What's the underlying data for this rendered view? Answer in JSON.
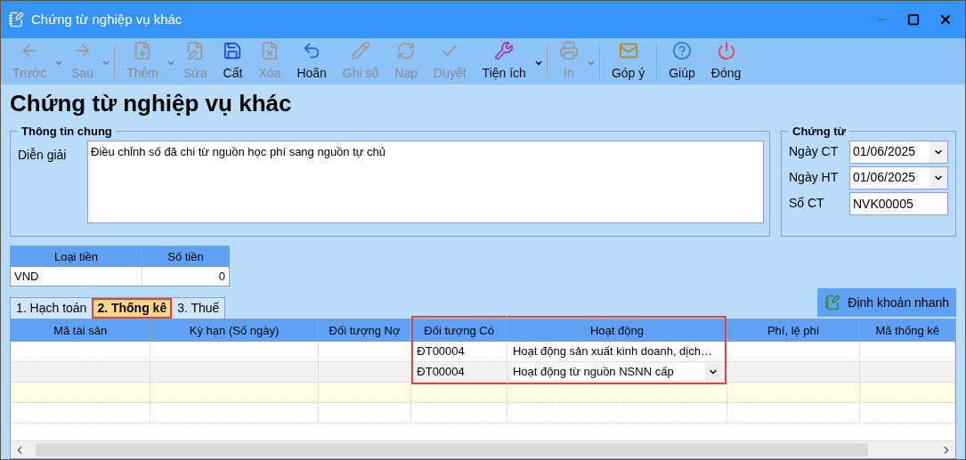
{
  "window": {
    "title": "Chứng từ nghiệp vụ khác"
  },
  "toolbar": [
    {
      "kind": "button",
      "label": "Trước",
      "disabled": true,
      "dropdown": true
    },
    {
      "kind": "button",
      "label": "Sau",
      "disabled": true,
      "dropdown": true
    },
    {
      "kind": "separator"
    },
    {
      "kind": "button",
      "label": "Thêm",
      "disabled": true,
      "dropdown": true
    },
    {
      "kind": "button",
      "label": "Sửa",
      "disabled": true,
      "dropdown": false
    },
    {
      "kind": "button",
      "label": "Cất",
      "disabled": false,
      "dropdown": false
    },
    {
      "kind": "button",
      "label": "Xóa",
      "disabled": true,
      "dropdown": false
    },
    {
      "kind": "button",
      "label": "Hoãn",
      "disabled": false,
      "dropdown": false
    },
    {
      "kind": "button",
      "label": "Ghi sổ",
      "disabled": true,
      "dropdown": false
    },
    {
      "kind": "button",
      "label": "Nạp",
      "disabled": true,
      "dropdown": false
    },
    {
      "kind": "button",
      "label": "Duyệt",
      "disabled": true,
      "dropdown": false
    },
    {
      "kind": "button",
      "label": "Tiện ích",
      "disabled": false,
      "dropdown": true
    },
    {
      "kind": "separator"
    },
    {
      "kind": "button",
      "label": "In",
      "disabled": true,
      "dropdown": true
    },
    {
      "kind": "separator"
    },
    {
      "kind": "button",
      "label": "Góp ý",
      "disabled": false,
      "dropdown": false
    },
    {
      "kind": "separator"
    },
    {
      "kind": "button",
      "label": "Giúp",
      "disabled": false,
      "dropdown": false
    },
    {
      "kind": "button",
      "label": "Đóng",
      "disabled": false,
      "dropdown": false
    }
  ],
  "heading": "Chứng từ nghiệp vụ khác",
  "general": {
    "title": "Thông tin chung",
    "label": "Diễn giải",
    "value": "Điều chỉnh số đã chi từ nguồn học phí sang nguồn tự chủ"
  },
  "voucher": {
    "title": "Chứng từ",
    "fields": [
      {
        "kind": "date",
        "label": "Ngày CT",
        "value": "01/06/2025"
      },
      {
        "kind": "date",
        "label": "Ngày HT",
        "value": "01/06/2025"
      },
      {
        "kind": "text",
        "label": "Số CT",
        "value": "NVK00005"
      }
    ]
  },
  "currency": {
    "columns": [
      "Loại tiền",
      "Số tiền"
    ],
    "row": [
      "VND",
      "0"
    ]
  },
  "tabs": [
    {
      "label": "1. Hạch toán",
      "selected": false,
      "highlighted": false
    },
    {
      "label": "2. Thống kê",
      "selected": true,
      "highlighted": true
    },
    {
      "label": "3. Thuế",
      "selected": false,
      "highlighted": false
    }
  ],
  "quick_button": "Định khoản nhanh",
  "grid": {
    "columns": [
      {
        "label": "Mã tài sản",
        "highlighted": false
      },
      {
        "label": "Kỳ hạn (Số ngày)",
        "highlighted": false
      },
      {
        "label": "Đối tượng Nợ",
        "highlighted": false
      },
      {
        "label": "Đối tượng Có",
        "highlighted": true
      },
      {
        "label": "Hoạt động",
        "highlighted": true
      },
      {
        "label": "Phí, lệ phí",
        "highlighted": false
      },
      {
        "label": "Mã thống kê",
        "highlighted": false
      }
    ],
    "rows": [
      {
        "kind": "data",
        "editing": false,
        "doi_tuong_co": "ĐT00004",
        "hoat_dong": "Hoạt động sản xuất kinh doanh, dịch…"
      },
      {
        "kind": "data",
        "editing": true,
        "doi_tuong_co": "ĐT00004",
        "hoat_dong": "Hoạt động từ nguồn NSNN cấp"
      },
      {
        "kind": "new"
      },
      {
        "kind": "blank"
      }
    ]
  }
}
